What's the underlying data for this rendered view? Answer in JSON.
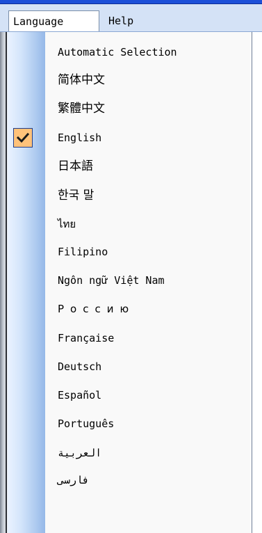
{
  "menubar": {
    "items": [
      {
        "label": "Language"
      },
      {
        "label": "Help"
      }
    ]
  },
  "language_menu": {
    "items": [
      {
        "label": "Automatic Selection",
        "checked": false
      },
      {
        "label": "简体中文",
        "checked": false
      },
      {
        "label": "繁體中文",
        "checked": false
      },
      {
        "label": "English",
        "checked": true
      },
      {
        "label": "日本語",
        "checked": false
      },
      {
        "label": "한국 말",
        "checked": false
      },
      {
        "label": "ไทย",
        "checked": false
      },
      {
        "label": "Filipino",
        "checked": false
      },
      {
        "label": "Ngôn ngữ Việt Nam",
        "checked": false
      },
      {
        "label": "Россию",
        "checked": false
      },
      {
        "label": "Française",
        "checked": false
      },
      {
        "label": "Deutsch",
        "checked": false
      },
      {
        "label": "Español",
        "checked": false
      },
      {
        "label": "Português",
        "checked": false
      },
      {
        "label": "العربية",
        "checked": false
      },
      {
        "label": "فارسی",
        "checked": false
      }
    ]
  },
  "icons": {
    "checked_marker": "checkmark-icon"
  },
  "colors": {
    "menubar_bg": "#d4e2f6",
    "check_highlight": "#ffc27a",
    "gutter_blue": "#a9c7ee"
  }
}
